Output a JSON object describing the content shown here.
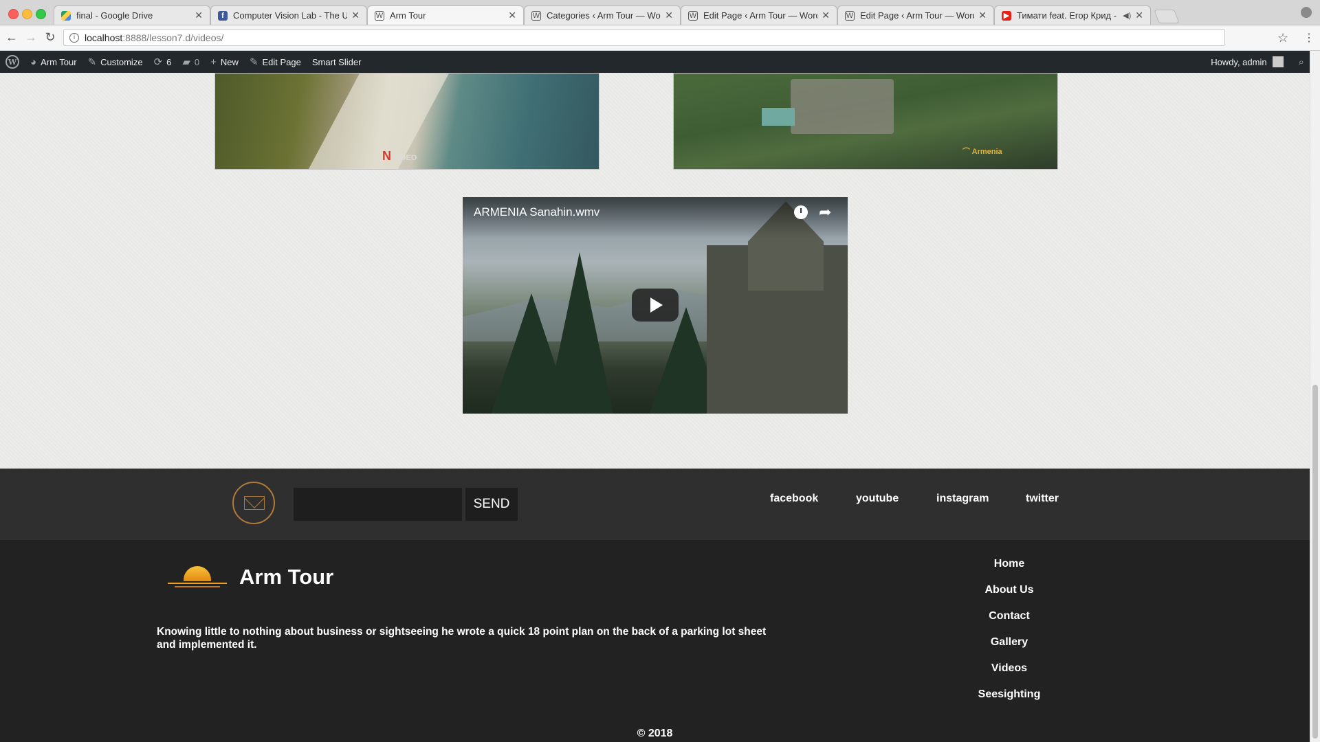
{
  "browser": {
    "tabs": [
      {
        "title": "final - Google Drive",
        "icon": "google-drive-icon"
      },
      {
        "title": "Computer Vision Lab - The Un",
        "icon": "facebook-icon"
      },
      {
        "title": "Arm Tour",
        "icon": "wordpress-icon",
        "active": true
      },
      {
        "title": "Categories ‹ Arm Tour — Word",
        "icon": "wordpress-icon"
      },
      {
        "title": "Edit Page ‹ Arm Tour — WordP",
        "icon": "wordpress-icon"
      },
      {
        "title": "Edit Page ‹ Arm Tour — WordP",
        "icon": "wordpress-icon"
      },
      {
        "title": "Тимати feat. Егор Крид - ",
        "icon": "youtube-icon"
      }
    ],
    "url_host": "localhost",
    "url_path": ":8888/lesson7.d/videos/"
  },
  "adminbar": {
    "site_name": "Arm Tour",
    "customize": "Customize",
    "updates_count": "6",
    "comments_count": "0",
    "new_label": "New",
    "edit_page": "Edit Page",
    "smart_slider": "Smart Slider",
    "howdy": "Howdy, admin"
  },
  "videos": {
    "main_title": "ARMENIA Sanahin.wmv",
    "left_logo": "VIDEO",
    "right_logo": "Armenia"
  },
  "subscribe": {
    "placeholder": "",
    "send_label": "SEND",
    "social": [
      "facebook",
      "youtube",
      "instagram",
      "twitter"
    ]
  },
  "footer": {
    "brand": "Arm Tour",
    "about": "Knowing little to nothing about business or sightseeing he wrote a quick 18 point plan on the back of a parking lot sheet and implemented it.",
    "nav": [
      "Home",
      "About Us",
      "Contact",
      "Gallery",
      "Videos",
      "Seesighting"
    ],
    "copyright": "© 2018"
  },
  "colors": {
    "admin_bar": "#23282d",
    "footer_top": "#2f2f2f",
    "footer": "#222222",
    "accent_gold": "#b07a3a"
  }
}
